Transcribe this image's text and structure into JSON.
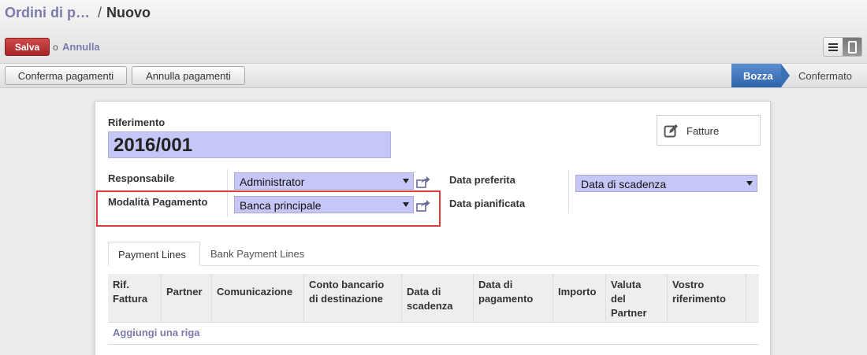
{
  "breadcrumb": {
    "parent": "Ordini di p…",
    "separator": "/",
    "current": "Nuovo"
  },
  "actions": {
    "save_label": "Salva",
    "or_text": "o",
    "discard_label": "Annulla"
  },
  "view_switch": {
    "icons": [
      "list-icon",
      "form-icon"
    ],
    "active": "form-icon"
  },
  "statusbar": {
    "buttons": [
      "Conferma pagamenti",
      "Annulla pagamenti"
    ],
    "stages": [
      {
        "label": "Bozza",
        "active": true
      },
      {
        "label": "Confermato",
        "active": false
      }
    ]
  },
  "form": {
    "reference_label": "Riferimento",
    "reference_value": "2016/001",
    "smart_button": {
      "label": "Fatture",
      "icon": "pencil-square-icon"
    },
    "responsible_label": "Responsabile",
    "responsible_value": "Administrator",
    "payment_mode_label": "Modalità Pagamento",
    "payment_mode_value": "Banca principale",
    "preferred_date_label": "Data preferita",
    "preferred_date_value": "Data di scadenza",
    "planned_date_label": "Data pianificata"
  },
  "tabs": [
    {
      "label": "Payment Lines",
      "active": true
    },
    {
      "label": "Bank Payment Lines",
      "active": false
    }
  ],
  "table": {
    "columns": [
      [
        "Rif.",
        "Fattura"
      ],
      [
        "Partner"
      ],
      [
        "Comunicazione"
      ],
      [
        "Conto bancario",
        "di destinazione"
      ],
      [
        "",
        "Data di",
        "scadenza"
      ],
      [
        "Data di",
        "pagamento"
      ],
      [
        "Importo"
      ],
      [
        "Valuta",
        "del",
        "Partner"
      ],
      [
        "Vostro",
        "riferimento"
      ]
    ],
    "add_line": "Aggiungi una riga"
  },
  "colors": {
    "accent": "#7c7bad",
    "save": "#b52c2c",
    "stage_active": "#3a70b6",
    "field_bg": "#c7c7f7",
    "highlight": "#e03a3a"
  }
}
